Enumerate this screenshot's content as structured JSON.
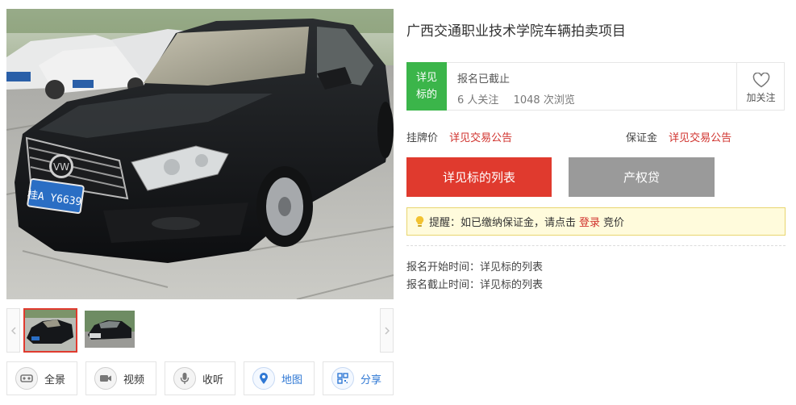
{
  "title": "广西交通职业技术学院车辆拍卖项目",
  "status": {
    "tag_line1": "详见",
    "tag_line2": "标的",
    "text": "报名已截止",
    "follow_count": "6",
    "follow_label": "人关注",
    "view_count": "1048",
    "view_label": "次浏览",
    "follow_button": "加关注"
  },
  "price": {
    "listing_label": "挂牌价",
    "listing_value": "详见交易公告",
    "deposit_label": "保证金",
    "deposit_value": "详见交易公告"
  },
  "buttons": {
    "primary": "详见标的列表",
    "secondary": "产权贷"
  },
  "tip": {
    "before": "提醒：如已缴纳保证金，请点击",
    "link": "登录",
    "after": "竞价"
  },
  "times": {
    "start": "报名开始时间：详见标的列表",
    "end": "报名截止时间：详见标的列表"
  },
  "tools": [
    {
      "label": "全景",
      "icon": "vr-glasses-icon"
    },
    {
      "label": "视频",
      "icon": "video-camera-icon"
    },
    {
      "label": "收听",
      "icon": "microphone-icon"
    },
    {
      "label": "地图",
      "icon": "map-pin-icon"
    },
    {
      "label": "分享",
      "icon": "qr-code-icon"
    }
  ],
  "photo": {
    "plate": "桂A Y6639"
  },
  "colors": {
    "accent_red": "#e03a2e",
    "tag_green": "#3bb54a",
    "button_gray": "#9a9a9a",
    "link_blue": "#2f78d4"
  }
}
